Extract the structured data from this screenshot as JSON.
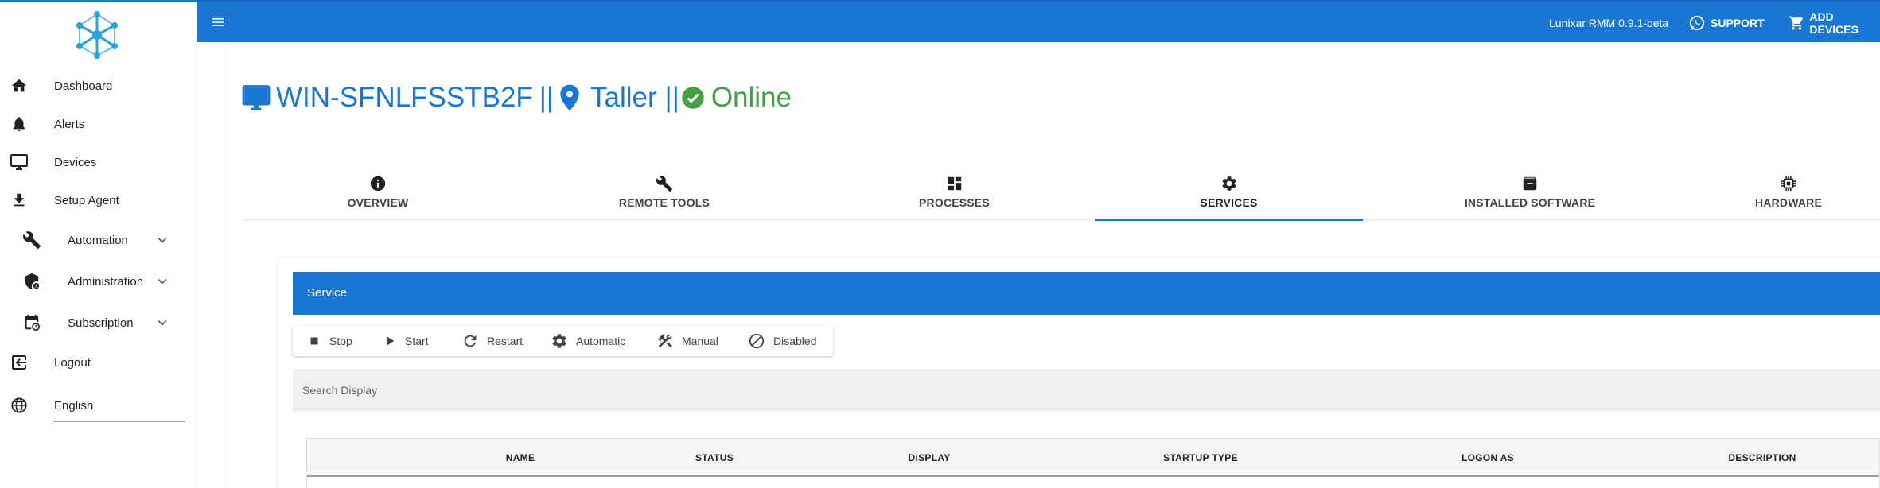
{
  "colors": {
    "primary": "#1976d2",
    "online": "#43a047"
  },
  "sidebar": {
    "logo_icon": "molecule-hub-icon",
    "items": [
      {
        "label": "Dashboard",
        "icon": "home-icon"
      },
      {
        "label": "Alerts",
        "icon": "bell-icon"
      },
      {
        "label": "Devices",
        "icon": "monitor-icon"
      },
      {
        "label": "Setup Agent",
        "icon": "download-icon"
      },
      {
        "label": "Automation",
        "icon": "wrench-icon",
        "expandable": true
      },
      {
        "label": "Administration",
        "icon": "admin-shield-icon",
        "expandable": true
      },
      {
        "label": "Subscription",
        "icon": "calendar-clock-icon",
        "expandable": true
      },
      {
        "label": "Logout",
        "icon": "logout-icon"
      },
      {
        "label": "English",
        "icon": "globe-icon"
      }
    ]
  },
  "appbar": {
    "menu_icon": "hamburger-menu-icon",
    "version": "Lunixar RMM 0.9.1-beta",
    "support_label": "SUPPORT",
    "add_devices_label": "ADD DEVICES"
  },
  "device": {
    "hostname": "WIN-SFNLFSSTB2F",
    "separator": "||",
    "location": "Taller",
    "status": "Online"
  },
  "tabs": [
    {
      "label": "OVERVIEW",
      "icon": "info-icon"
    },
    {
      "label": "REMOTE TOOLS",
      "icon": "wrench-icon"
    },
    {
      "label": "PROCESSES",
      "icon": "dashboard-icon"
    },
    {
      "label": "SERVICES",
      "icon": "gear-icon",
      "active": true
    },
    {
      "label": "INSTALLED SOFTWARE",
      "icon": "archive-icon"
    },
    {
      "label": "HARDWARE",
      "icon": "chip-icon"
    }
  ],
  "service_panel": {
    "title": "Service",
    "actions": [
      {
        "label": "Stop",
        "icon": "stop-icon"
      },
      {
        "label": "Start",
        "icon": "play-icon"
      },
      {
        "label": "Restart",
        "icon": "refresh-icon"
      },
      {
        "label": "Automatic",
        "icon": "gear-icon"
      },
      {
        "label": "Manual",
        "icon": "tools-icon"
      },
      {
        "label": "Disabled",
        "icon": "block-icon"
      }
    ],
    "search_placeholder": "Search Display",
    "columns": [
      "NAME",
      "STATUS",
      "DISPLAY",
      "STARTUP TYPE",
      "LOGON AS",
      "DESCRIPTION"
    ]
  }
}
